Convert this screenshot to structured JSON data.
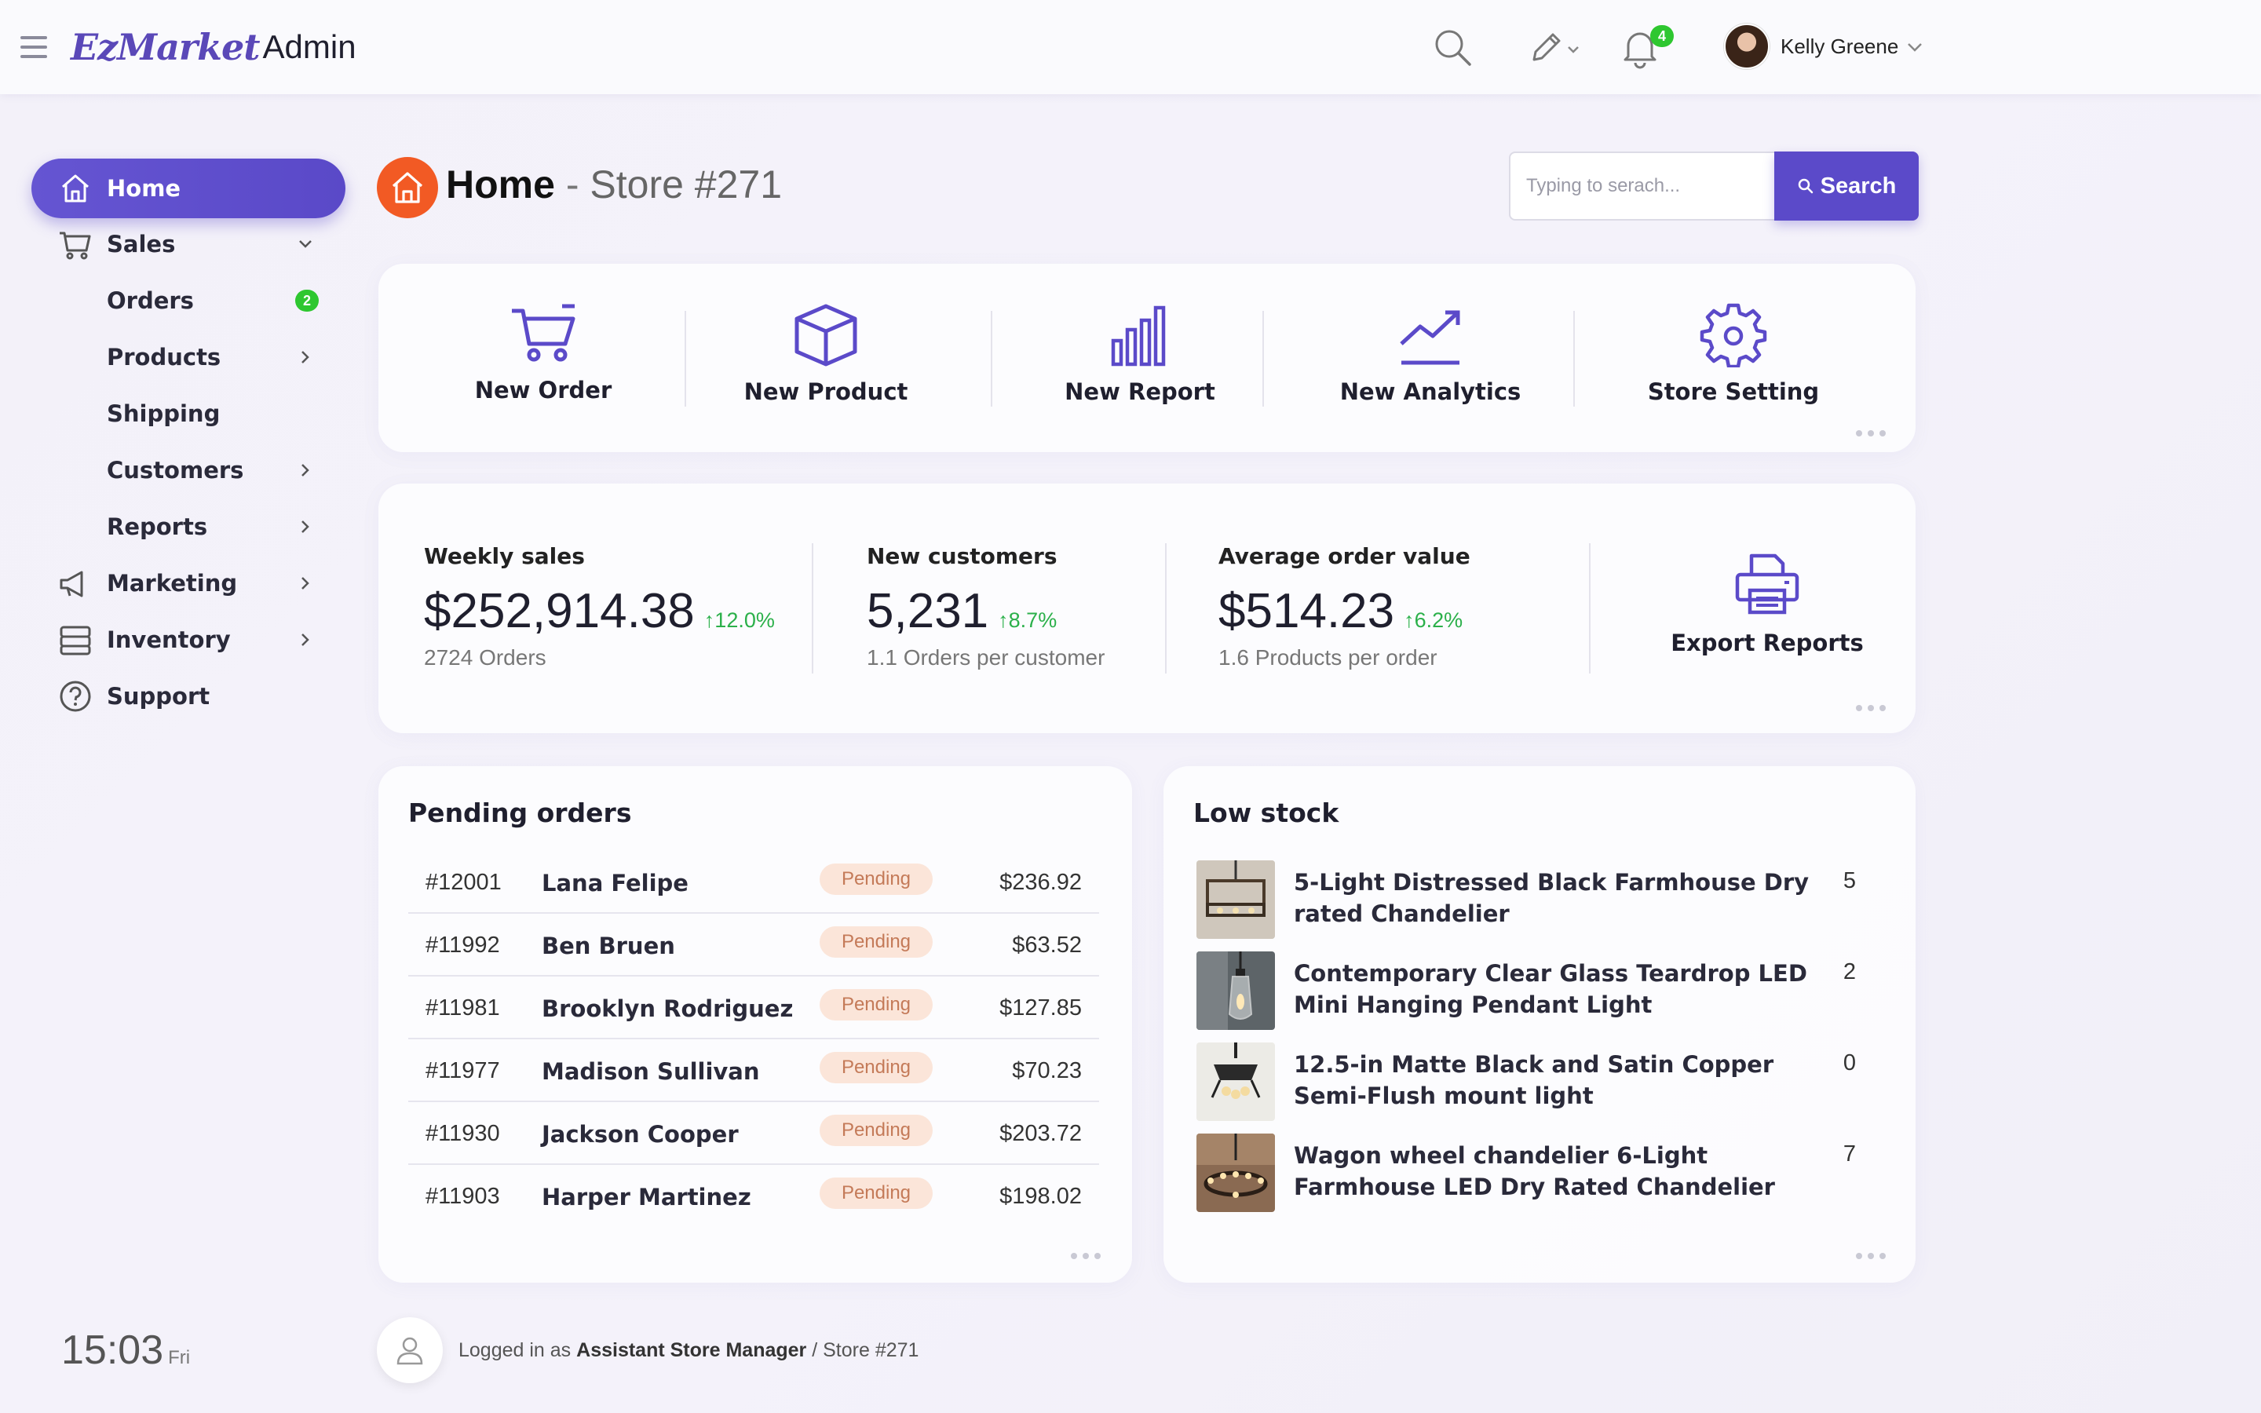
{
  "brand": {
    "script": "EzMarket",
    "suffix": "Admin",
    "accent": "#5a48b8"
  },
  "topbar": {
    "notifications_count": "4",
    "user_name": "Kelly Greene"
  },
  "sidebar": {
    "home": "Home",
    "sales": "Sales",
    "orders": "Orders",
    "orders_badge": "2",
    "products": "Products",
    "shipping": "Shipping",
    "customers": "Customers",
    "reports": "Reports",
    "marketing": "Marketing",
    "inventory": "Inventory",
    "support": "Support"
  },
  "clock": {
    "time": "15:03",
    "day": "Fri"
  },
  "header": {
    "title": "Home",
    "separator": "-",
    "store": "Store #271",
    "search_placeholder": "Typing to serach...",
    "search_button": "Search"
  },
  "quick_actions": [
    "New Order",
    "New Product",
    "New Report",
    "New Analytics",
    "Store Setting"
  ],
  "stats": [
    {
      "title": "Weekly sales",
      "value": "$252,914.38",
      "delta": "↑12.0%",
      "sub": "2724 Orders"
    },
    {
      "title": "New customers",
      "value": "5,231",
      "delta": "↑8.7%",
      "sub": "1.1 Orders per customer"
    },
    {
      "title": "Average order value",
      "value": "$514.23",
      "delta": "↑6.2%",
      "sub": "1.6 Products per order"
    }
  ],
  "export_label": "Export Reports",
  "pending": {
    "title": "Pending orders",
    "rows": [
      {
        "id": "#12001",
        "name": "Lana Felipe",
        "status": "Pending",
        "amount": "$236.92"
      },
      {
        "id": "#11992",
        "name": "Ben Bruen",
        "status": "Pending",
        "amount": "$63.52"
      },
      {
        "id": "#11981",
        "name": "Brooklyn Rodriguez",
        "status": "Pending",
        "amount": "$127.85"
      },
      {
        "id": "#11977",
        "name": "Madison Sullivan",
        "status": "Pending",
        "amount": "$70.23"
      },
      {
        "id": "#11930",
        "name": "Jackson Cooper",
        "status": "Pending",
        "amount": "$203.72"
      },
      {
        "id": "#11903",
        "name": "Harper Martinez",
        "status": "Pending",
        "amount": "$198.02"
      }
    ]
  },
  "lowstock": {
    "title": "Low stock",
    "rows": [
      {
        "name": "5-Light Distressed Black Farmhouse Dry rated Chandelier",
        "qty": "5"
      },
      {
        "name": "Contemporary Clear Glass Teardrop LED Mini Hanging Pendant Light",
        "qty": "2"
      },
      {
        "name": "12.5-in Matte Black and Satin Copper Semi-Flush mount light",
        "qty": "0"
      },
      {
        "name": "Wagon wheel chandelier 6-Light Farmhouse LED Dry Rated Chandelier",
        "qty": "7"
      }
    ]
  },
  "footer": {
    "prefix": "Logged in as",
    "role": "Assistant Store Manager",
    "suffix": "/ Store #271"
  }
}
